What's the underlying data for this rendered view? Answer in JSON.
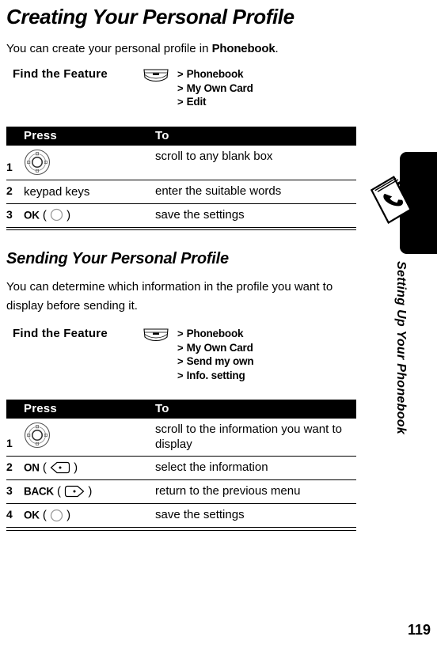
{
  "document": {
    "page_number": "119",
    "rail_title": "Setting Up Your Phonebook",
    "rail_icon": "phonebook-icon"
  },
  "section1": {
    "title": "Creating Your Personal Profile",
    "intro_before": "You can create your personal profile in ",
    "intro_bold": "Phonebook",
    "intro_after": ".",
    "find_the_feature": {
      "label": "Find the Feature",
      "key_icon": "menu-key-icon",
      "path": [
        "Phonebook",
        "My Own Card",
        "Edit"
      ],
      "separator": ">"
    },
    "table": {
      "headers": {
        "num": "",
        "press": "Press",
        "to": "To"
      },
      "rows": [
        {
          "num": "1",
          "press_icon": "navigation-key-icon",
          "press": "",
          "to": "scroll to any blank box"
        },
        {
          "num": "2",
          "press_icon": "",
          "press": "keypad keys",
          "to": "enter the suitable words"
        },
        {
          "num": "3",
          "press_icon": "round-ok-key-icon",
          "press": "OK",
          "to": "save the settings"
        }
      ]
    }
  },
  "section2": {
    "title": "Sending Your Personal Profile",
    "intro": "You can determine which information in the profile you want to display before sending it.",
    "find_the_feature": {
      "label": "Find the Feature",
      "key_icon": "menu-key-icon",
      "path": [
        "Phonebook",
        "My Own Card",
        "Send my own",
        "Info. setting"
      ],
      "separator": ">"
    },
    "table": {
      "headers": {
        "num": "",
        "press": "Press",
        "to": "To"
      },
      "rows": [
        {
          "num": "1",
          "press_icon": "navigation-key-icon",
          "press": "",
          "to": "scroll to the information you want to display"
        },
        {
          "num": "2",
          "press_icon": "left-soft-key-icon",
          "press": "ON",
          "to": "select the information"
        },
        {
          "num": "3",
          "press_icon": "right-soft-key-icon",
          "press": "BACK",
          "to": "return to the previous menu"
        },
        {
          "num": "4",
          "press_icon": "round-ok-key-icon",
          "press": "OK",
          "to": "save the settings"
        }
      ]
    }
  }
}
